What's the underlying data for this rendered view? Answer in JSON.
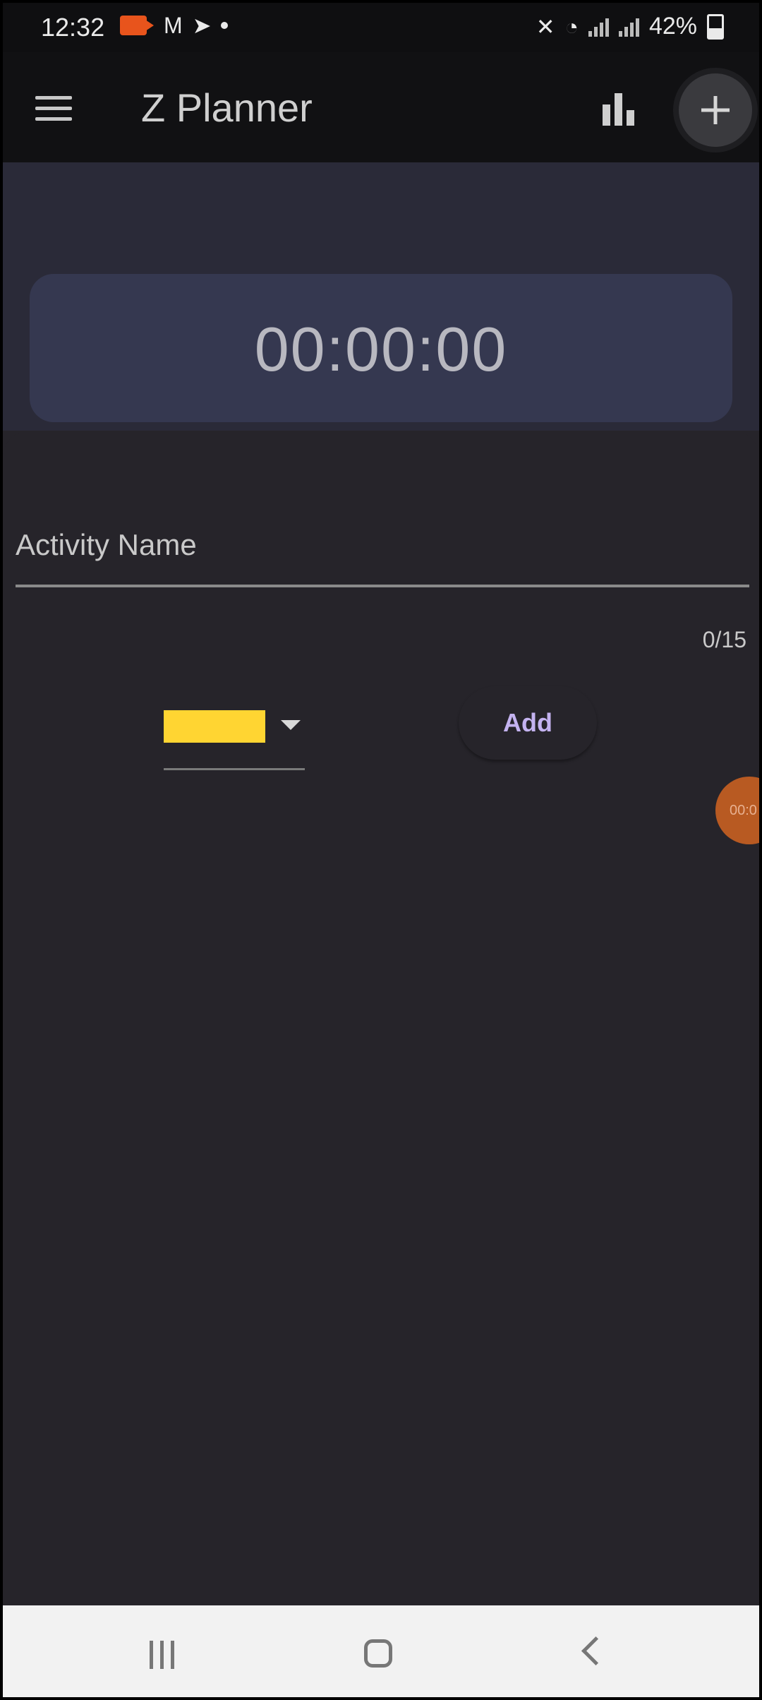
{
  "status_bar": {
    "time": "12:32",
    "battery": "42%",
    "icons": [
      "screen-record-icon",
      "gmail-icon",
      "telegram-icon",
      "dot-icon",
      "mute-icon",
      "wifi-icon",
      "signal-icon",
      "signal-icon",
      "battery-icon"
    ]
  },
  "app_bar": {
    "title": "Z Planner",
    "menu_icon": "menu-icon",
    "stats_icon": "bar-chart-icon",
    "add_icon": "plus-icon"
  },
  "timer": {
    "value": "00:00:00"
  },
  "form": {
    "activity_label": "Activity Name",
    "activity_value": "",
    "counter": "0/15",
    "color_selected": "#ffd532",
    "add_label": "Add"
  },
  "floating_timer": {
    "text": "00:0"
  },
  "nav": {
    "recents": "recents-icon",
    "home": "home-icon",
    "back": "back-icon"
  }
}
